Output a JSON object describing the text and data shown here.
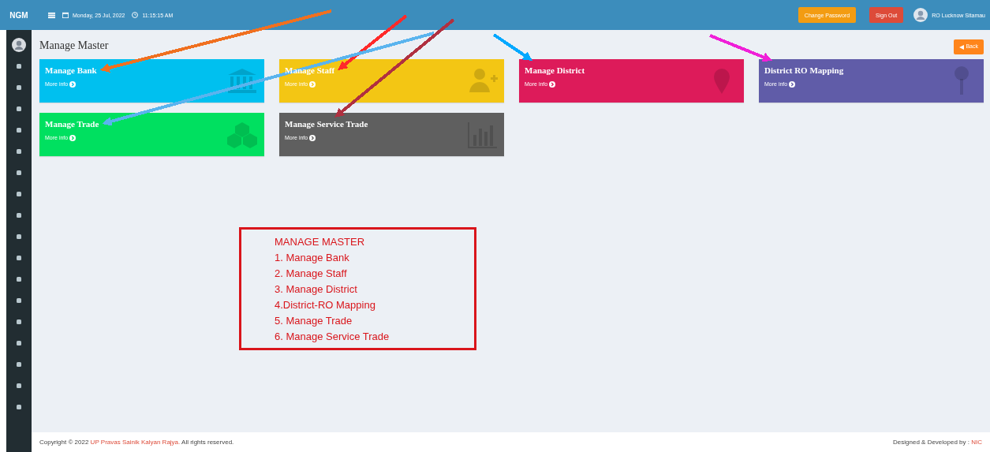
{
  "header": {
    "logo": "NGM",
    "date": "Monday, 25 Jul, 2022",
    "time": "11:15:15 AM",
    "change_password": "Change Password",
    "sign_out": "Sign Out",
    "user": "RO Lucknow Sitamau"
  },
  "page": {
    "title": "Manage Master",
    "back": "Back"
  },
  "cards": [
    {
      "title": "Manage Bank",
      "link": "More info",
      "color": "#00c0ef"
    },
    {
      "title": "Manage Staff",
      "link": "More info",
      "color": "#f3c614"
    },
    {
      "title": "Manage District",
      "link": "More info",
      "color": "#dd1b5a"
    },
    {
      "title": "District RO Mapping",
      "link": "More info",
      "color": "#605ca8"
    },
    {
      "title": "Manage Trade",
      "link": "More info",
      "color": "#00e060"
    },
    {
      "title": "Manage Service Trade",
      "link": "More info",
      "color": "#5f5f5f"
    }
  ],
  "note": {
    "lines": [
      "MANAGE MASTER",
      "1. Manage Bank",
      "2. Manage Staff",
      "3. Manage District",
      "4.District-RO Mapping",
      "5. Manage Trade",
      "6. Manage Service Trade"
    ]
  },
  "annotation_arrows": [
    {
      "color": "#f07020"
    },
    {
      "color": "#ff2a2a"
    },
    {
      "color": "#5ab4ee"
    },
    {
      "color": "#b03040"
    },
    {
      "color": "#00a8ff"
    },
    {
      "color": "#f020d8"
    }
  ],
  "footer": {
    "copyright": "Copyright © 2022",
    "org": "UP Pravas Sainik Kalyan Rajya.",
    "rights": "All rights reserved.",
    "credit": "Designed & Developed by :",
    "credit_org": "NIC"
  }
}
